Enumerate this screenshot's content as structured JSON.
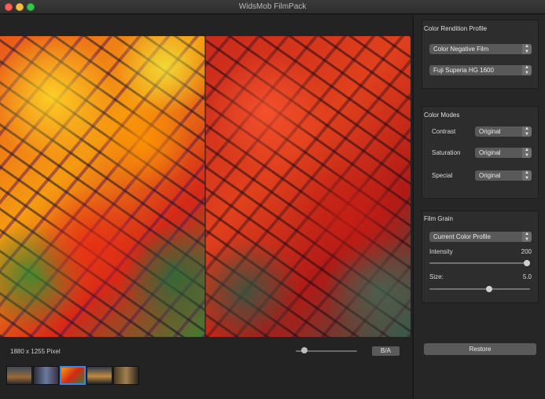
{
  "window": {
    "title": "WidsMob FilmPack"
  },
  "canvas": {
    "dimensions": "1880 x 1255 Pixel",
    "ba_label": "B/A",
    "zoom_level": 0.1
  },
  "thumbnails": [
    {
      "name": "thumb-1",
      "active": false
    },
    {
      "name": "thumb-2",
      "active": false
    },
    {
      "name": "thumb-3",
      "active": true
    },
    {
      "name": "thumb-4",
      "active": false
    },
    {
      "name": "thumb-5",
      "active": false
    }
  ],
  "sidebar": {
    "color_rendition": {
      "title": "Color Rendition Profile",
      "profile_value": "Color Negative Film",
      "film_value": "Fuji Superia HG 1600"
    },
    "color_modes": {
      "title": "Color Modes",
      "contrast_label": "Contrast",
      "contrast_value": "Original",
      "saturation_label": "Saturation",
      "saturation_value": "Original",
      "special_label": "Special",
      "special_value": "Original"
    },
    "film_grain": {
      "title": "Film Grain",
      "source_value": "Current Color Profile",
      "intensity_label": "Intensity",
      "intensity_value": "200",
      "intensity_fraction": 1.0,
      "size_label": "Size:",
      "size_value": "5.0",
      "size_fraction": 0.6
    },
    "restore_label": "Restore"
  },
  "colors": {
    "accent": "#3a86e6"
  }
}
